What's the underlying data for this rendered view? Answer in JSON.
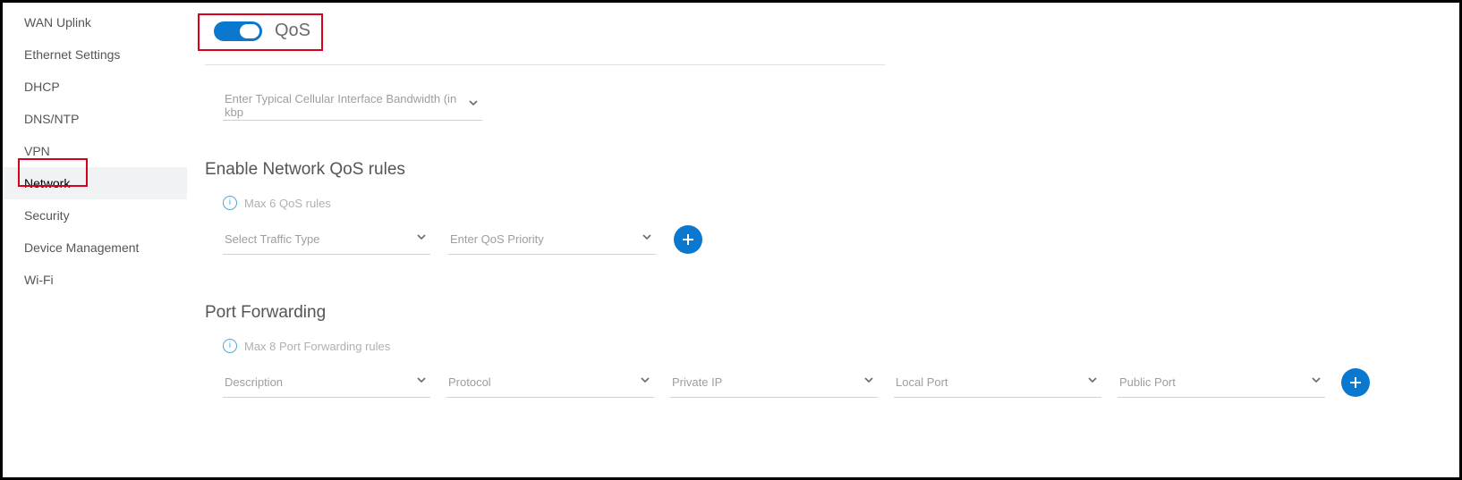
{
  "sidebar": {
    "items": [
      {
        "label": "WAN Uplink"
      },
      {
        "label": "Ethernet Settings"
      },
      {
        "label": "DHCP"
      },
      {
        "label": "DNS/NTP"
      },
      {
        "label": "VPN"
      },
      {
        "label": "Network",
        "active": true
      },
      {
        "label": "Security"
      },
      {
        "label": "Device Management"
      },
      {
        "label": "Wi-Fi"
      }
    ]
  },
  "qos": {
    "toggle_label": "QoS",
    "toggle_on": true,
    "bandwidth_placeholder": "Enter Typical Cellular Interface Bandwidth (in kbp"
  },
  "qos_rules": {
    "section_title": "Enable Network QoS rules",
    "info": "Max 6 QoS rules",
    "traffic_placeholder": "Select Traffic Type",
    "priority_placeholder": "Enter QoS Priority"
  },
  "port_forwarding": {
    "section_title": "Port Forwarding",
    "info": "Max 8 Port Forwarding rules",
    "fields": {
      "description": "Description",
      "protocol": "Protocol",
      "private_ip": "Private IP",
      "local_port": "Local Port",
      "public_port": "Public Port"
    }
  },
  "colors": {
    "accent": "#0b78d0",
    "annotation": "#d9001b"
  }
}
